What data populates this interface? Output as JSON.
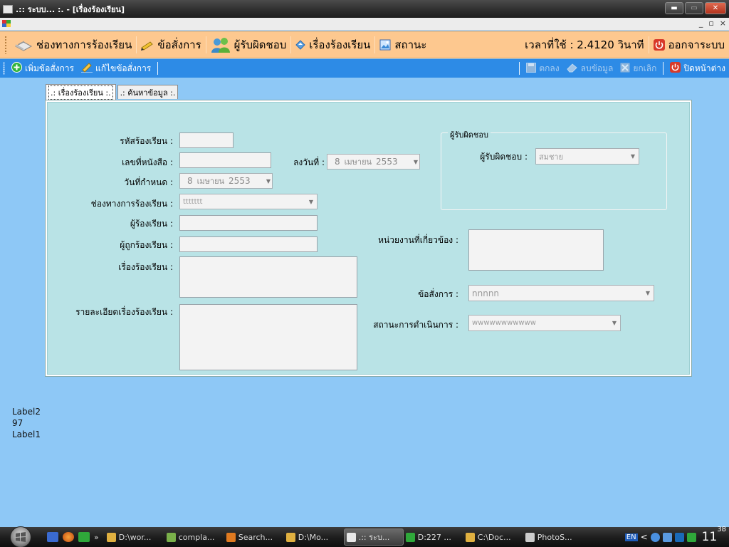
{
  "window": {
    "title": ".:: ระบบ... :. - [เรื่องร้องเรียน]"
  },
  "mdi": {
    "min": "_",
    "restore": "▫",
    "close": "×"
  },
  "menu": {
    "items": [
      {
        "label": "ช่องทางการร้องเรียน",
        "icon": "book-icon"
      },
      {
        "label": "ข้อสั่งการ",
        "icon": "pencil-icon"
      },
      {
        "label": "ผู้รับผิดชอบ",
        "icon": "users-icon"
      },
      {
        "label": "เรื่องร้องเรียน",
        "icon": "document-icon"
      },
      {
        "label": "สถานะ",
        "icon": "picture-icon"
      }
    ],
    "time_label": "เวลาที่ใช้ : 2.4120 วินาที",
    "exit_label": "ออกจาระบบ"
  },
  "toolbar": {
    "add_label": "เพิ่มข้อสั่งการ",
    "edit_label": "แก้ไขข้อสั่งการ",
    "save_label": "ตกลง",
    "delete_label": "ลบข้อมูล",
    "cancel_label": "ยกเลิก",
    "close_label": "ปิดหน้าต่าง"
  },
  "tabs": [
    {
      "label": ".: เรื่องร้องเรียน :.",
      "active": true
    },
    {
      "label": ".: ค้นหาข้อมูล :.",
      "active": false
    }
  ],
  "form": {
    "complaint_code_label": "รหัสร้องเรียน :",
    "complaint_code_value": "",
    "doc_number_label": "เลขที่หนังสือ :",
    "doc_number_value": "",
    "doc_date_label": "ลงวันที่ :",
    "doc_date": {
      "day": "8",
      "month": "เมษายน",
      "year": "2553"
    },
    "due_date_label": "วันที่กำหนด :",
    "due_date": {
      "day": "8",
      "month": "เมษายน",
      "year": "2553"
    },
    "channel_label": "ช่องทางการร้องเรียน  :",
    "channel_value": "ttttttt",
    "complainant_label": "ผู้ร้องเรียน :",
    "complainant_value": "",
    "accused_label": "ผู้ถูกร้องเรียน :",
    "accused_value": "",
    "subject_label": "เรื่องร้องเรียน :",
    "subject_value": "",
    "detail_label": "รายละเอียดเรื่องร้องเรียน :",
    "detail_value": "",
    "responsible_group_title": "ผู้รับผิดชอบ",
    "responsible_label": "ผู้รับผิดชอบ :",
    "responsible_value": "สมชาย",
    "agency_label": "หน่วยงานที่เกี่ยวข้อง :",
    "agency_value": "",
    "command_label": "ข้อสั่งการ :",
    "command_value": "nnnnn",
    "status_label": "สถานะการดำเนินการ :",
    "status_value": "wwwwwwwwwww"
  },
  "debug": {
    "label2": "Label2",
    "value": "97",
    "label1": "Label1"
  },
  "taskbar": {
    "tasks": [
      {
        "label": "D:\\wor...",
        "color": "#e0b040"
      },
      {
        "label": "compla...",
        "color": "#7ab04a"
      },
      {
        "label": "Search...",
        "color": "#e07a20"
      },
      {
        "label": "D:\\Mo...",
        "color": "#e0b040"
      },
      {
        "label": ".:: ระบ...",
        "color": "#e8e8e8",
        "active": true
      },
      {
        "label": "D:227 ...",
        "color": "#2fa83a"
      },
      {
        "label": "C:\\Doc...",
        "color": "#e0b040"
      },
      {
        "label": "PhotoS...",
        "color": "#cccccc"
      }
    ],
    "lang": "EN",
    "clock_hour": "11",
    "clock_min": "38"
  }
}
